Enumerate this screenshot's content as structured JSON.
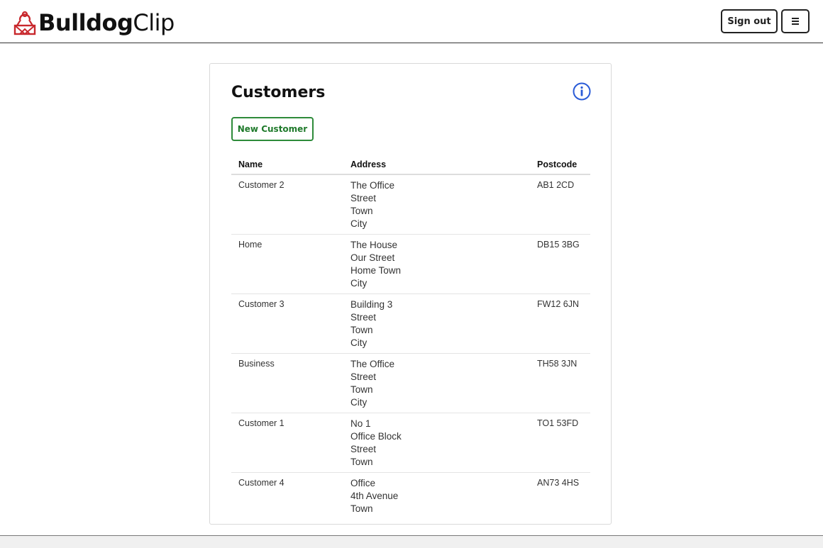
{
  "header": {
    "brand_bold": "Bulldog",
    "brand_light": "Clip",
    "signout_label": "Sign out",
    "menu_icon": "hamburger-icon",
    "logo_icon": "bulldog-clip-icon"
  },
  "colors": {
    "accent_green": "#2e8b3a",
    "info_blue": "#2a5bd7",
    "brand_red": "#c8282d"
  },
  "main": {
    "title": "Customers",
    "new_button_label": "New Customer",
    "info_icon": "info-icon",
    "table": {
      "headers": [
        "Name",
        "Address",
        "Postcode"
      ],
      "rows": [
        {
          "name": "Customer 2",
          "address": [
            "The Office",
            "Street",
            "Town",
            "City"
          ],
          "postcode": "AB1 2CD"
        },
        {
          "name": "Home",
          "address": [
            "The House",
            "Our Street",
            "Home Town",
            "City"
          ],
          "postcode": "DB15 3BG"
        },
        {
          "name": "Customer 3",
          "address": [
            "Building 3",
            "Street",
            "Town",
            "City"
          ],
          "postcode": "FW12 6JN"
        },
        {
          "name": "Business",
          "address": [
            "The Office",
            "Street",
            "Town",
            "City"
          ],
          "postcode": "TH58 3JN"
        },
        {
          "name": "Customer 1",
          "address": [
            "No 1",
            "Office Block",
            "Street",
            "Town"
          ],
          "postcode": "TO1 53FD"
        },
        {
          "name": "Customer 4",
          "address": [
            "Office",
            "4th Avenue",
            "Town"
          ],
          "postcode": "AN73 4HS"
        }
      ]
    }
  }
}
